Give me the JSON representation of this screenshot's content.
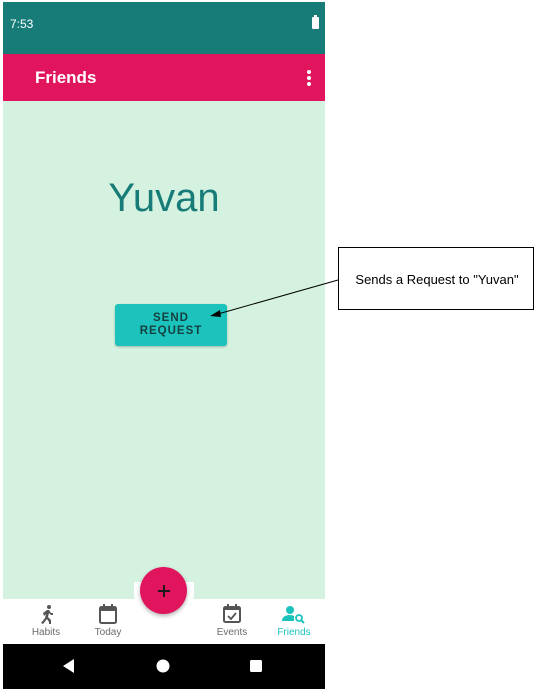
{
  "status_bar": {
    "time": "7:53",
    "battery_icon": "battery-full-icon"
  },
  "app_bar": {
    "title": "Friends",
    "menu_icon": "more-vert-icon"
  },
  "content": {
    "friend_name": "Yuvan",
    "send_button_label": "SEND\nREQUEST"
  },
  "fab": {
    "icon": "plus-icon",
    "label": "+"
  },
  "bottom_nav": {
    "items": [
      {
        "label": "Habits",
        "icon": "running-person-icon",
        "active": false
      },
      {
        "label": "Today",
        "icon": "calendar-icon",
        "active": false
      },
      {
        "label": "Events",
        "icon": "calendar-check-icon",
        "active": false
      },
      {
        "label": "Friends",
        "icon": "person-search-icon",
        "active": true
      }
    ]
  },
  "system_nav": {
    "back_icon": "back-triangle-icon",
    "home_icon": "home-circle-icon",
    "recents_icon": "recents-square-icon"
  },
  "annotation": {
    "text": "Sends a Request to \"Yuvan\""
  },
  "colors": {
    "status_bar": "#177c78",
    "app_bar": "#e0155e",
    "background": "#d4f2df",
    "accent": "#1cc3bd",
    "name_text": "#177c78"
  }
}
